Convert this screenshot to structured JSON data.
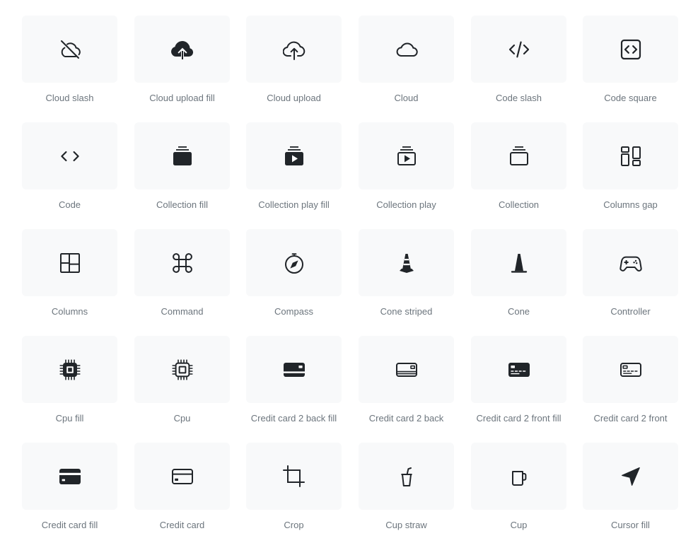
{
  "icons": [
    {
      "name": "cloud-slash-icon",
      "label": "Cloud slash"
    },
    {
      "name": "cloud-upload-fill-icon",
      "label": "Cloud upload fill"
    },
    {
      "name": "cloud-upload-icon",
      "label": "Cloud upload"
    },
    {
      "name": "cloud-icon",
      "label": "Cloud"
    },
    {
      "name": "code-slash-icon",
      "label": "Code slash"
    },
    {
      "name": "code-square-icon",
      "label": "Code square"
    },
    {
      "name": "code-icon",
      "label": "Code"
    },
    {
      "name": "collection-fill-icon",
      "label": "Collection fill"
    },
    {
      "name": "collection-play-fill-icon",
      "label": "Collection play fill"
    },
    {
      "name": "collection-play-icon",
      "label": "Collection play"
    },
    {
      "name": "collection-icon",
      "label": "Collection"
    },
    {
      "name": "columns-gap-icon",
      "label": "Columns gap"
    },
    {
      "name": "columns-icon",
      "label": "Columns"
    },
    {
      "name": "command-icon",
      "label": "Command"
    },
    {
      "name": "compass-icon",
      "label": "Compass"
    },
    {
      "name": "cone-striped-icon",
      "label": "Cone striped"
    },
    {
      "name": "cone-icon",
      "label": "Cone"
    },
    {
      "name": "controller-icon",
      "label": "Controller"
    },
    {
      "name": "cpu-fill-icon",
      "label": "Cpu fill"
    },
    {
      "name": "cpu-icon",
      "label": "Cpu"
    },
    {
      "name": "credit-card-2-back-fill-icon",
      "label": "Credit card 2 back fill"
    },
    {
      "name": "credit-card-2-back-icon",
      "label": "Credit card 2 back"
    },
    {
      "name": "credit-card-2-front-fill-icon",
      "label": "Credit card 2 front fill"
    },
    {
      "name": "credit-card-2-front-icon",
      "label": "Credit card 2 front"
    },
    {
      "name": "credit-card-fill-icon",
      "label": "Credit card fill"
    },
    {
      "name": "credit-card-icon",
      "label": "Credit card"
    },
    {
      "name": "crop-icon",
      "label": "Crop"
    },
    {
      "name": "cup-straw-icon",
      "label": "Cup straw"
    },
    {
      "name": "cup-icon",
      "label": "Cup"
    },
    {
      "name": "cursor-fill-icon",
      "label": "Cursor fill"
    }
  ],
  "colors": {
    "icon": "#212529",
    "tile": "#f8f9fa",
    "label": "#6c757d"
  }
}
